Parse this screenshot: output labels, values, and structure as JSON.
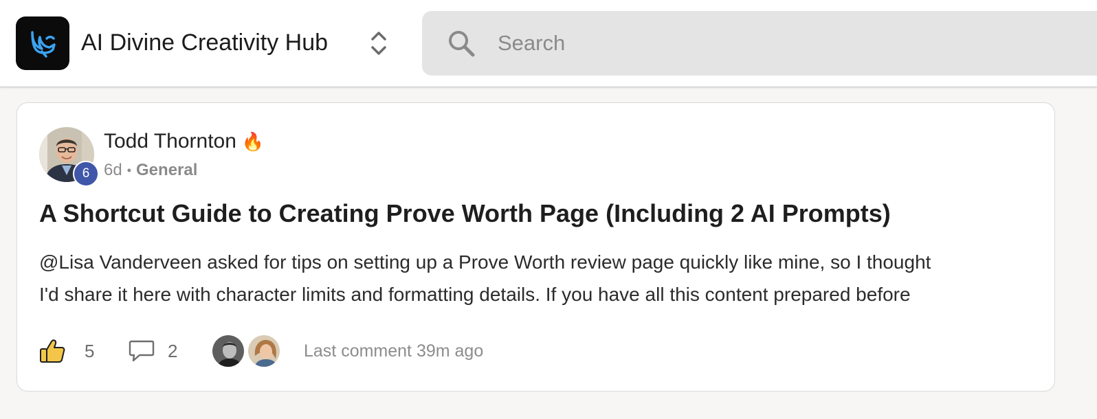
{
  "header": {
    "app_title": "AI Divine Creativity Hub",
    "logo_icon": "bird-icon",
    "switcher_icon": "chevron-up-down-icon",
    "search": {
      "placeholder": "Search",
      "value": ""
    }
  },
  "post": {
    "author": {
      "name": "Todd Thornton",
      "emoji": "🔥",
      "level": "6"
    },
    "time": "6d",
    "separator": "•",
    "category": "General",
    "title": "A Shortcut Guide to Creating Prove Worth Page (Including 2 AI Prompts)",
    "body_lines": [
      "@Lisa Vanderveen asked for tips on setting up a Prove Worth review page quickly like mine, so I thought",
      "I'd share it here with character limits and formatting details. If you have all this content prepared before"
    ],
    "likes": "5",
    "comments": "2",
    "last_comment": "Last comment 39m ago"
  },
  "colors": {
    "logo_bg": "#0b0b0c",
    "logo_accent": "#3ba3f0",
    "level_badge": "#3f56a9",
    "like_thumb": "#f3c64a"
  }
}
